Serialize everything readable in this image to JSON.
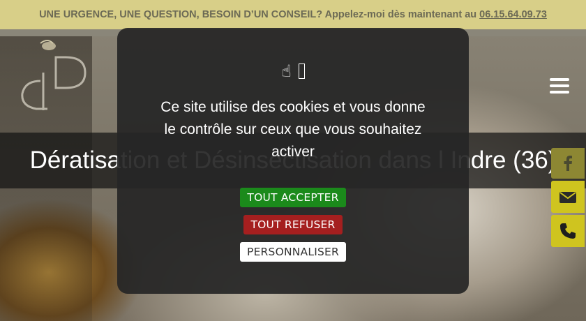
{
  "topbar": {
    "text": "UNE URGENCE, UNE QUESTION, BESOIN D’UN CONSEIL? Appelez-moi dès maintenant au",
    "phone": "06.15.64.09.73"
  },
  "header": {
    "logo_icon": "bee-d-logo-icon",
    "menu_icon": "hamburger-menu-icon"
  },
  "hero": {
    "title": "Dératisation et Désinsectisation dans l Indre (36)"
  },
  "side_buttons": [
    {
      "icon": "facebook-icon"
    },
    {
      "icon": "envelope-icon"
    },
    {
      "icon": "phone-icon"
    }
  ],
  "cookie_modal": {
    "icon_hand": "☝",
    "message": "Ce site utilise des cookies et vous donne le contrôle sur ceux que vous souhaitez activer",
    "accept_label": "TOUT ACCEPTER",
    "refuse_label": "TOUT REFUSER",
    "customize_label": "PERSONNALISER"
  },
  "colors": {
    "topbar_bg": "#d8cf88",
    "accent_yellow": "#cfc41f",
    "accept_green": "#1b8a1b",
    "refuse_red": "#a51f1f"
  }
}
